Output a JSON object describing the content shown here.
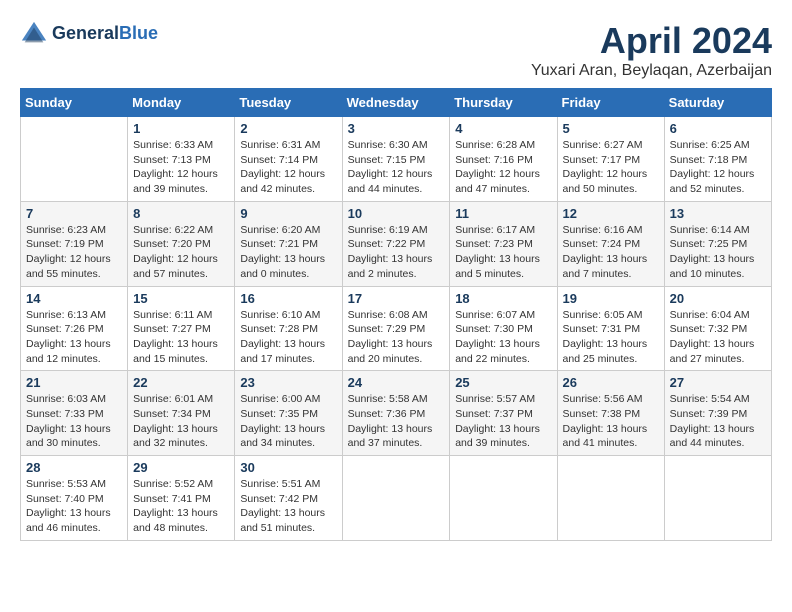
{
  "logo": {
    "line1": "General",
    "line2": "Blue"
  },
  "title": "April 2024",
  "subtitle": "Yuxari Aran, Beylaqan, Azerbaijan",
  "weekdays": [
    "Sunday",
    "Monday",
    "Tuesday",
    "Wednesday",
    "Thursday",
    "Friday",
    "Saturday"
  ],
  "weeks": [
    [
      {
        "day": "",
        "info": ""
      },
      {
        "day": "1",
        "info": "Sunrise: 6:33 AM\nSunset: 7:13 PM\nDaylight: 12 hours\nand 39 minutes."
      },
      {
        "day": "2",
        "info": "Sunrise: 6:31 AM\nSunset: 7:14 PM\nDaylight: 12 hours\nand 42 minutes."
      },
      {
        "day": "3",
        "info": "Sunrise: 6:30 AM\nSunset: 7:15 PM\nDaylight: 12 hours\nand 44 minutes."
      },
      {
        "day": "4",
        "info": "Sunrise: 6:28 AM\nSunset: 7:16 PM\nDaylight: 12 hours\nand 47 minutes."
      },
      {
        "day": "5",
        "info": "Sunrise: 6:27 AM\nSunset: 7:17 PM\nDaylight: 12 hours\nand 50 minutes."
      },
      {
        "day": "6",
        "info": "Sunrise: 6:25 AM\nSunset: 7:18 PM\nDaylight: 12 hours\nand 52 minutes."
      }
    ],
    [
      {
        "day": "7",
        "info": "Sunrise: 6:23 AM\nSunset: 7:19 PM\nDaylight: 12 hours\nand 55 minutes."
      },
      {
        "day": "8",
        "info": "Sunrise: 6:22 AM\nSunset: 7:20 PM\nDaylight: 12 hours\nand 57 minutes."
      },
      {
        "day": "9",
        "info": "Sunrise: 6:20 AM\nSunset: 7:21 PM\nDaylight: 13 hours\nand 0 minutes."
      },
      {
        "day": "10",
        "info": "Sunrise: 6:19 AM\nSunset: 7:22 PM\nDaylight: 13 hours\nand 2 minutes."
      },
      {
        "day": "11",
        "info": "Sunrise: 6:17 AM\nSunset: 7:23 PM\nDaylight: 13 hours\nand 5 minutes."
      },
      {
        "day": "12",
        "info": "Sunrise: 6:16 AM\nSunset: 7:24 PM\nDaylight: 13 hours\nand 7 minutes."
      },
      {
        "day": "13",
        "info": "Sunrise: 6:14 AM\nSunset: 7:25 PM\nDaylight: 13 hours\nand 10 minutes."
      }
    ],
    [
      {
        "day": "14",
        "info": "Sunrise: 6:13 AM\nSunset: 7:26 PM\nDaylight: 13 hours\nand 12 minutes."
      },
      {
        "day": "15",
        "info": "Sunrise: 6:11 AM\nSunset: 7:27 PM\nDaylight: 13 hours\nand 15 minutes."
      },
      {
        "day": "16",
        "info": "Sunrise: 6:10 AM\nSunset: 7:28 PM\nDaylight: 13 hours\nand 17 minutes."
      },
      {
        "day": "17",
        "info": "Sunrise: 6:08 AM\nSunset: 7:29 PM\nDaylight: 13 hours\nand 20 minutes."
      },
      {
        "day": "18",
        "info": "Sunrise: 6:07 AM\nSunset: 7:30 PM\nDaylight: 13 hours\nand 22 minutes."
      },
      {
        "day": "19",
        "info": "Sunrise: 6:05 AM\nSunset: 7:31 PM\nDaylight: 13 hours\nand 25 minutes."
      },
      {
        "day": "20",
        "info": "Sunrise: 6:04 AM\nSunset: 7:32 PM\nDaylight: 13 hours\nand 27 minutes."
      }
    ],
    [
      {
        "day": "21",
        "info": "Sunrise: 6:03 AM\nSunset: 7:33 PM\nDaylight: 13 hours\nand 30 minutes."
      },
      {
        "day": "22",
        "info": "Sunrise: 6:01 AM\nSunset: 7:34 PM\nDaylight: 13 hours\nand 32 minutes."
      },
      {
        "day": "23",
        "info": "Sunrise: 6:00 AM\nSunset: 7:35 PM\nDaylight: 13 hours\nand 34 minutes."
      },
      {
        "day": "24",
        "info": "Sunrise: 5:58 AM\nSunset: 7:36 PM\nDaylight: 13 hours\nand 37 minutes."
      },
      {
        "day": "25",
        "info": "Sunrise: 5:57 AM\nSunset: 7:37 PM\nDaylight: 13 hours\nand 39 minutes."
      },
      {
        "day": "26",
        "info": "Sunrise: 5:56 AM\nSunset: 7:38 PM\nDaylight: 13 hours\nand 41 minutes."
      },
      {
        "day": "27",
        "info": "Sunrise: 5:54 AM\nSunset: 7:39 PM\nDaylight: 13 hours\nand 44 minutes."
      }
    ],
    [
      {
        "day": "28",
        "info": "Sunrise: 5:53 AM\nSunset: 7:40 PM\nDaylight: 13 hours\nand 46 minutes."
      },
      {
        "day": "29",
        "info": "Sunrise: 5:52 AM\nSunset: 7:41 PM\nDaylight: 13 hours\nand 48 minutes."
      },
      {
        "day": "30",
        "info": "Sunrise: 5:51 AM\nSunset: 7:42 PM\nDaylight: 13 hours\nand 51 minutes."
      },
      {
        "day": "",
        "info": ""
      },
      {
        "day": "",
        "info": ""
      },
      {
        "day": "",
        "info": ""
      },
      {
        "day": "",
        "info": ""
      }
    ]
  ]
}
